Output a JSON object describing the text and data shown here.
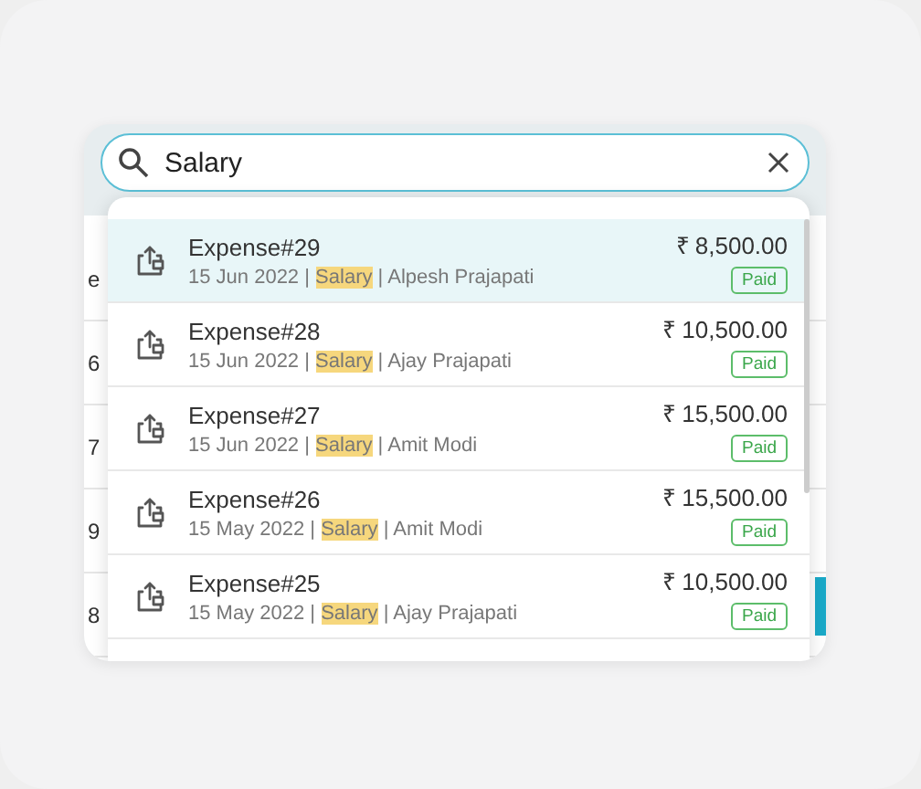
{
  "search": {
    "value": "Salary"
  },
  "separator": "|",
  "background_table": {
    "cells": [
      "e",
      "6",
      "7",
      "9",
      "8"
    ]
  },
  "results": [
    {
      "title": "Expense#29",
      "date": "15 Jun 2022",
      "category": "Salary",
      "category_highlighted": true,
      "person": "Alpesh Prajapati",
      "amount": "₹ 8,500.00",
      "status": "Paid",
      "selected": true
    },
    {
      "title": "Expense#28",
      "date": "15 Jun 2022",
      "category": "Salary",
      "category_highlighted": true,
      "person": "Ajay Prajapati",
      "amount": "₹ 10,500.00",
      "status": "Paid",
      "selected": false
    },
    {
      "title": "Expense#27",
      "date": "15 Jun 2022",
      "category": "Salary",
      "category_highlighted": true,
      "person": "Amit Modi",
      "amount": "₹ 15,500.00",
      "status": "Paid",
      "selected": false
    },
    {
      "title": "Expense#26",
      "date": "15 May 2022",
      "category": "Salary",
      "category_highlighted": true,
      "person": "Amit Modi",
      "amount": "₹ 15,500.00",
      "status": "Paid",
      "selected": false
    },
    {
      "title": "Expense#25",
      "date": "15 May 2022",
      "category": "Salary",
      "category_highlighted": true,
      "person": "Ajay Prajapati",
      "amount": "₹ 10,500.00",
      "status": "Paid",
      "selected": false
    }
  ]
}
